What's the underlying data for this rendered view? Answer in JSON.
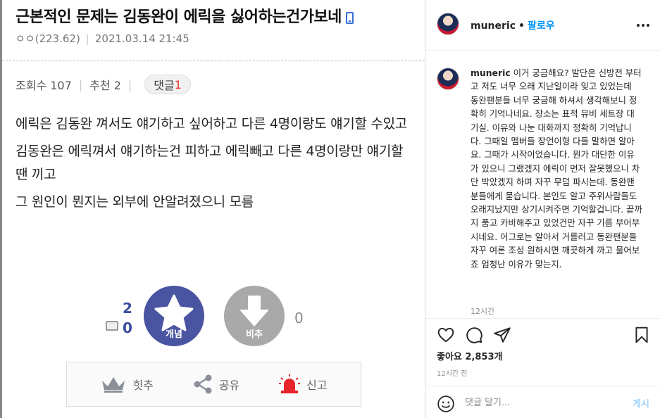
{
  "post": {
    "title": "근본적인 문제는 김동완이 에릭을 싫어하는건가보네",
    "author": "ㅇㅇ(223.62)",
    "datetime": "2021.03.14 21:45",
    "views_label": "조회수 107",
    "recommend_label": "추천 2",
    "reply_label": "댓글",
    "reply_count": "1",
    "paragraphs": [
      "에릭은 김동완 껴서도 얘기하고 싶어하고 다른 4명이랑도 얘기할 수있고",
      "김동완은 에릭껴서 얘기하는건 피하고 에릭빼고 다른 4명이랑만 얘기할땐 끼고",
      "그 원인이 뭔지는 외부에 안알려졌으니 모름"
    ],
    "vote": {
      "up_count": "2",
      "fixed_count": "0",
      "up_label": "개념",
      "down_label": "비추",
      "down_count": "0"
    },
    "actions": {
      "hit_label": "힛추",
      "share_label": "공유",
      "report_label": "신고"
    }
  },
  "instagram": {
    "username": "muneric",
    "follow_label": "팔로우",
    "caption": "이거 궁금해요? 발단은 신방전 부터고 저도 너무 오래 지난일이라 잊고 있었는데 동완팬분들 너무 궁금해 하셔서 생각해보니 정확히 기억나네요. 장소는 표적 뮤비 세트장 대기실. 이유와 나눈 대화까지 정확히 기억납니다. 그때일 멤버들 장언이형 다들 말하면 알아요. 그때가 시작이었습니다. 뭔가 대단한 이유가 있으니 그랬겠지 에릭이 먼저 잘못했으니 차단 박았겠지 하며 자꾸 무덤 파시는데. 동완팬분들에게 묻습니다. 본인도 알고 주위사람들도 오래지났지만 상기시켜주면 기억할겁니다. 끝까지 품고 카바해주고 있었건만 자꾸 기름 부어부시네요. 어그로는 알아서 거를러고 동완팬분들 자꾸 여론 조성 원하시면 깨끗하게 까고 물어보죠 엄청난 이유가 맞는지.",
    "caption_time": "12시간",
    "likes": "좋아요 2,853개",
    "post_time": "12시간 전",
    "comment_placeholder": "댓글 달기...",
    "post_label": "게시"
  },
  "colors": {
    "vote_up": "#4a55a2",
    "vote_down": "#a9a9a9",
    "report_red": "#e8242c",
    "ig_blue": "#0095f6"
  }
}
